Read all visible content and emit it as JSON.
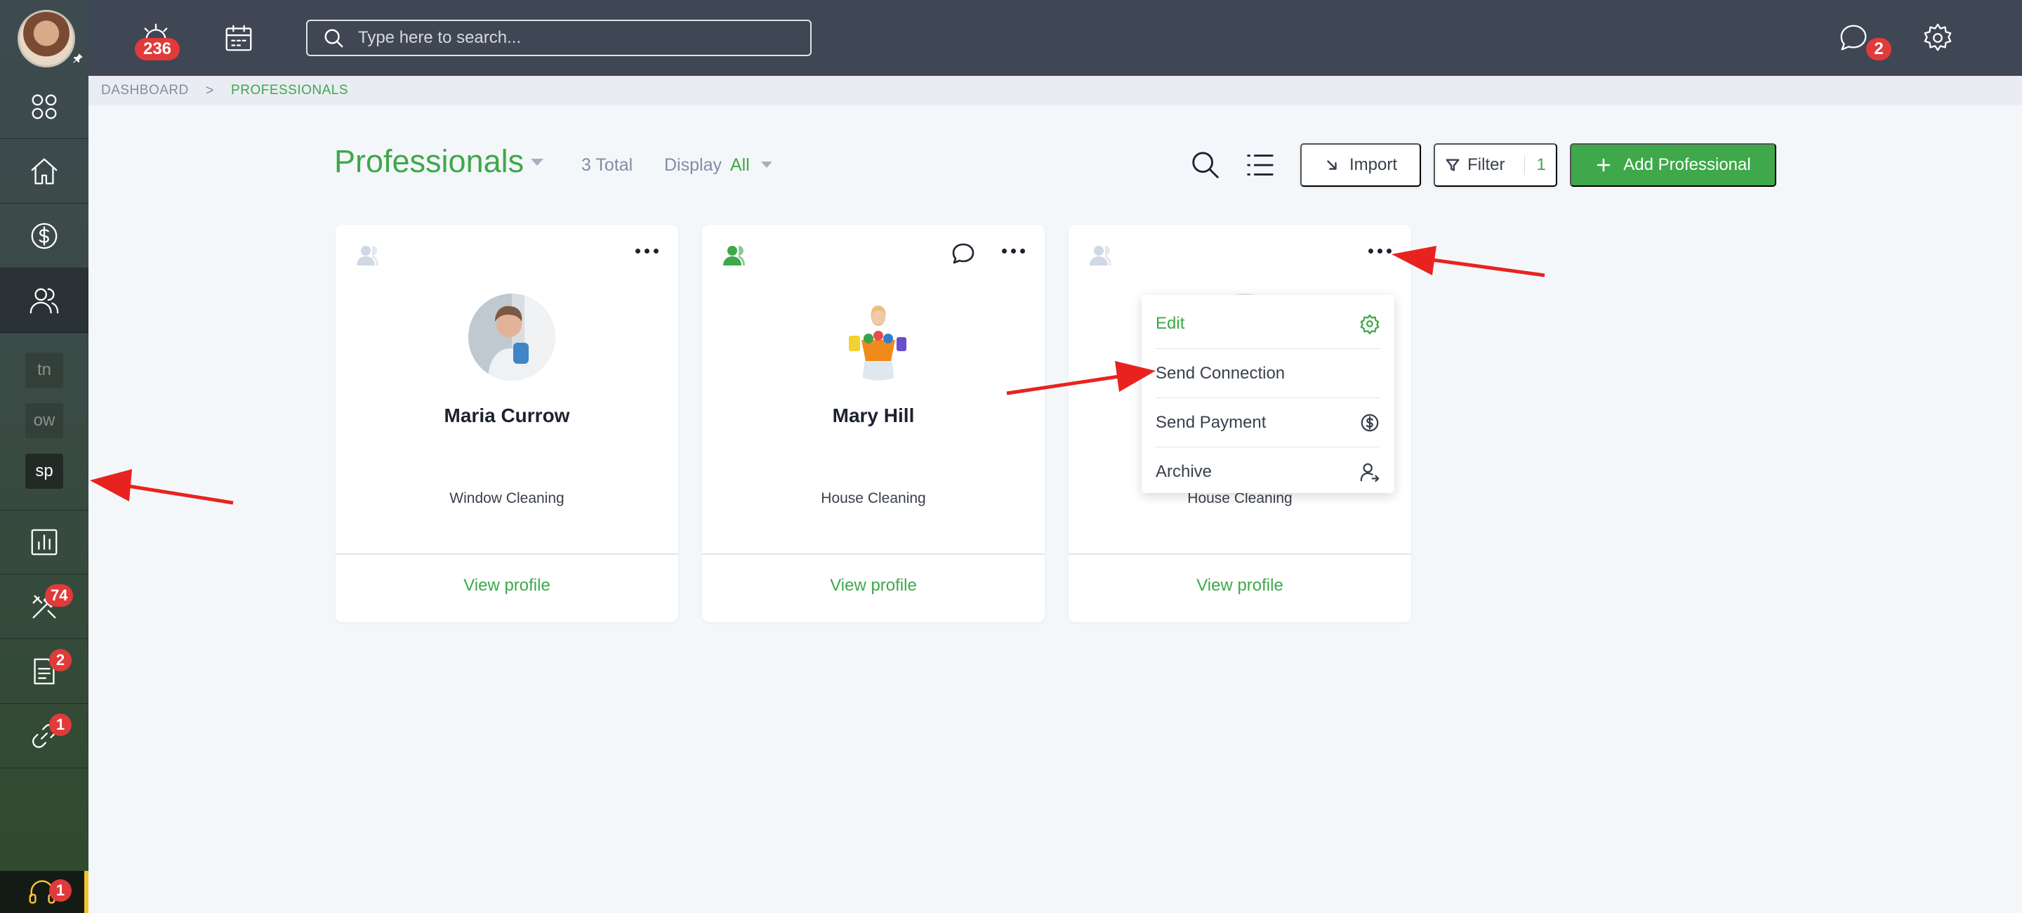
{
  "topbar": {
    "alarm_badge": "236",
    "search_placeholder": "Type here to search...",
    "chat_badge": "2"
  },
  "sidebar": {
    "tools_badge": "74",
    "documents_badge": "2",
    "integrations_badge": "1",
    "support_badge": "1",
    "tiles": [
      "tn",
      "ow",
      "sp"
    ]
  },
  "breadcrumb": {
    "root": "DASHBOARD",
    "separator": ">",
    "current": "PROFESSIONALS"
  },
  "header": {
    "title": "Professionals",
    "total": "3 Total",
    "display_label": "Display",
    "display_value": "All",
    "import_label": "Import",
    "filter_label": "Filter",
    "filter_count": "1",
    "add_label": "Add Professional"
  },
  "cards": [
    {
      "name": "Maria Currow",
      "service": "Window Cleaning",
      "link": "View profile",
      "connected": false
    },
    {
      "name": "Mary Hill",
      "service": "House Cleaning",
      "link": "View profile",
      "connected": true
    },
    {
      "name": "",
      "service": "House Cleaning",
      "link": "View profile",
      "connected": false
    }
  ],
  "menu": {
    "items": [
      "Edit",
      "Send Connection",
      "Send Payment",
      "Archive"
    ]
  },
  "colors": {
    "accent": "#3ea84a",
    "topbar": "#3f4654",
    "badge": "#e03a3a",
    "annotation_arrow": "#e8231f"
  }
}
